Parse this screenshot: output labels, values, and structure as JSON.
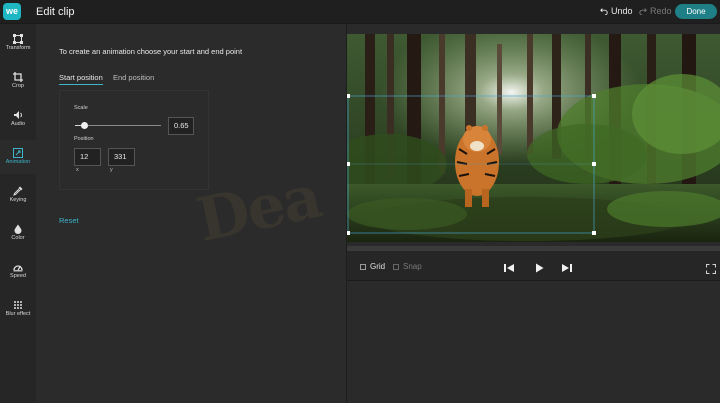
{
  "app": {
    "logo_text": "we",
    "title": "Edit clip"
  },
  "topbar": {
    "undo_label": "Undo",
    "redo_label": "Redo",
    "done_label": "Done"
  },
  "rail": [
    {
      "label": "Transform",
      "icon": "transform-icon"
    },
    {
      "label": "Crop",
      "icon": "crop-icon"
    },
    {
      "label": "Audio",
      "icon": "speaker-icon"
    },
    {
      "label": "Animation",
      "icon": "animation-icon",
      "active": true
    },
    {
      "label": "Keying",
      "icon": "eyedropper-icon"
    },
    {
      "label": "Color",
      "icon": "drop-icon"
    },
    {
      "label": "Speed",
      "icon": "speedometer-icon"
    },
    {
      "label": "Blur effect",
      "icon": "blur-grid-icon"
    }
  ],
  "panel": {
    "instruction": "To create an animation choose your start and end point",
    "tabs": [
      "Start position",
      "End position"
    ],
    "active_tab": "Start position",
    "scale_label": "Scale",
    "scale_value": "0.65",
    "scale_fraction": 0.1,
    "position_label": "Position",
    "x_value": "12",
    "y_value": "331",
    "x_label": "x",
    "y_label": "y",
    "reset_label": "Reset"
  },
  "preview": {
    "grid_label": "Grid",
    "snap_label": "Snap",
    "grid_checked": false,
    "snap_enabled": false
  },
  "watermark": "Dea",
  "colors": {
    "accent": "#3db4c8",
    "done_button": "#1f7f86",
    "logo": "#1fb6c4"
  }
}
